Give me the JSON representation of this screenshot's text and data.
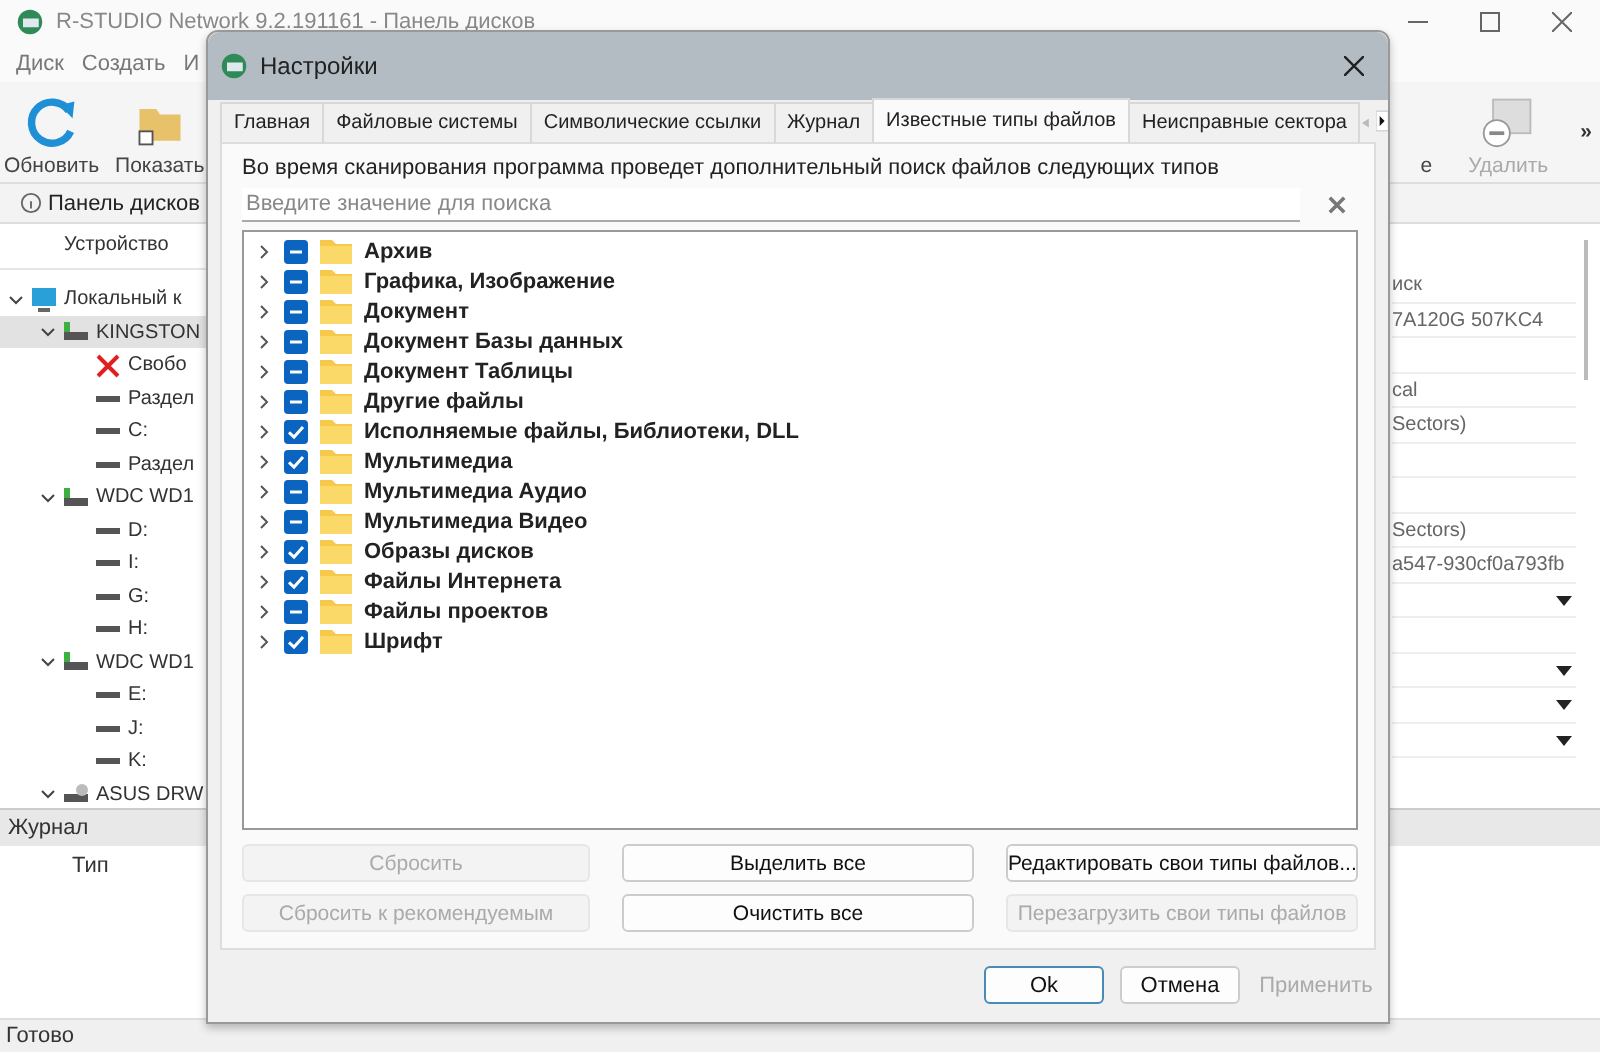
{
  "app": {
    "title": "R-STUDIO Network 9.2.191161 - Панель дисков",
    "menu": [
      "Диск",
      "Создать",
      "И"
    ],
    "toolbar_left": [
      {
        "label": "Обновить",
        "kind": "refresh"
      },
      {
        "label": "Показать",
        "kind": "show"
      }
    ],
    "toolbar_right": [
      {
        "label": "е",
        "kind": "none"
      },
      {
        "label": "Удалить",
        "kind": "delete"
      }
    ],
    "toolbar_more": "»",
    "panel_tab": "Панель дисков",
    "tree_header": "Устройство",
    "tree": [
      {
        "label": "Локальный к",
        "kind": "computer",
        "expanded": true,
        "selected": false,
        "children": [
          {
            "label": "KINGSTON",
            "kind": "disk",
            "expanded": true,
            "selected": true,
            "children": [
              {
                "label": "Свобо",
                "kind": "free",
                "selected": false
              },
              {
                "label": "Раздел",
                "kind": "partition",
                "selected": false
              },
              {
                "label": "C:",
                "kind": "partition",
                "selected": false
              },
              {
                "label": "Раздел",
                "kind": "partition",
                "selected": false
              }
            ]
          },
          {
            "label": "WDC WD1",
            "kind": "disk",
            "expanded": true,
            "selected": false,
            "children": [
              {
                "label": "D:",
                "kind": "partition",
                "selected": false
              },
              {
                "label": "I:",
                "kind": "partition",
                "selected": false
              },
              {
                "label": "G:",
                "kind": "partition",
                "selected": false
              },
              {
                "label": "H:",
                "kind": "partition",
                "selected": false
              }
            ]
          },
          {
            "label": "WDC WD1",
            "kind": "disk",
            "expanded": true,
            "selected": false,
            "children": [
              {
                "label": "E:",
                "kind": "partition",
                "selected": false
              },
              {
                "label": "J:",
                "kind": "partition",
                "selected": false
              },
              {
                "label": "K:",
                "kind": "partition",
                "selected": false
              }
            ]
          },
          {
            "label": "ASUS DRW",
            "kind": "optical",
            "expanded": true,
            "selected": false
          }
        ]
      }
    ],
    "properties": [
      {
        "kind": "text",
        "text": "иск"
      },
      {
        "kind": "text",
        "text": "7A120G 507KC4"
      },
      {
        "kind": "empty"
      },
      {
        "kind": "text",
        "text": "cal"
      },
      {
        "kind": "text",
        "text": "Sectors)"
      },
      {
        "kind": "empty"
      },
      {
        "kind": "empty"
      },
      {
        "kind": "text",
        "text": "Sectors)"
      },
      {
        "kind": "text",
        "text": "a547-930cf0a793fb"
      },
      {
        "kind": "dropdown"
      },
      {
        "kind": "empty"
      },
      {
        "kind": "dropdown"
      },
      {
        "kind": "dropdown"
      },
      {
        "kind": "dropdown"
      }
    ],
    "log_title": "Журнал",
    "log_column": "Тип",
    "status": "Готово"
  },
  "dialog": {
    "title": "Настройки",
    "tabs": [
      {
        "label": "Главная",
        "selected": false
      },
      {
        "label": "Файловые системы",
        "selected": false
      },
      {
        "label": "Символические ссылки",
        "selected": false
      },
      {
        "label": "Журнал",
        "selected": false
      },
      {
        "label": "Известные типы файлов",
        "selected": true
      },
      {
        "label": "Неисправные сектора",
        "selected": false
      }
    ],
    "description": "Во время сканирования программа проведет дополнительный поиск файлов следующих типов",
    "search": {
      "placeholder": "Введите значение для поиска"
    },
    "file_types": [
      {
        "label": "Архив",
        "checked": false,
        "partial": true,
        "expanded": false
      },
      {
        "label": "Графика, Изображение",
        "checked": false,
        "partial": true,
        "expanded": false
      },
      {
        "label": "Документ",
        "checked": false,
        "partial": true,
        "expanded": false
      },
      {
        "label": "Документ Базы данных",
        "checked": false,
        "partial": true,
        "expanded": false
      },
      {
        "label": "Документ Таблицы",
        "checked": false,
        "partial": true,
        "expanded": false
      },
      {
        "label": "Другие файлы",
        "checked": false,
        "partial": true,
        "expanded": false
      },
      {
        "label": "Исполняемые файлы, Библиотеки, DLL",
        "checked": true,
        "partial": false,
        "expanded": false
      },
      {
        "label": "Мультимедиа",
        "checked": true,
        "partial": false,
        "expanded": false
      },
      {
        "label": "Мультимедиа Аудио",
        "checked": false,
        "partial": true,
        "expanded": false
      },
      {
        "label": "Мультимедиа Видео",
        "checked": false,
        "partial": true,
        "expanded": false
      },
      {
        "label": "Образы дисков",
        "checked": true,
        "partial": false,
        "expanded": false
      },
      {
        "label": "Файлы Интернета",
        "checked": true,
        "partial": false,
        "expanded": false
      },
      {
        "label": "Файлы проектов",
        "checked": false,
        "partial": true,
        "expanded": false
      },
      {
        "label": "Шрифт",
        "checked": true,
        "partial": false,
        "expanded": false
      }
    ],
    "action_buttons": [
      {
        "label": "Сбросить",
        "disabled": true
      },
      {
        "label": "Выделить все",
        "disabled": false
      },
      {
        "label": "Редактировать свои типы файлов...",
        "disabled": false
      },
      {
        "label": "Сбросить к рекомендуемым",
        "disabled": true
      },
      {
        "label": "Очистить все",
        "disabled": false
      },
      {
        "label": "Перезагрузить свои типы файлов",
        "disabled": true
      }
    ],
    "footer_buttons": [
      {
        "label": "Ok",
        "disabled": false,
        "default": true
      },
      {
        "label": "Отмена",
        "disabled": false,
        "default": false
      },
      {
        "label": "Применить",
        "disabled": true,
        "default": false
      }
    ]
  }
}
